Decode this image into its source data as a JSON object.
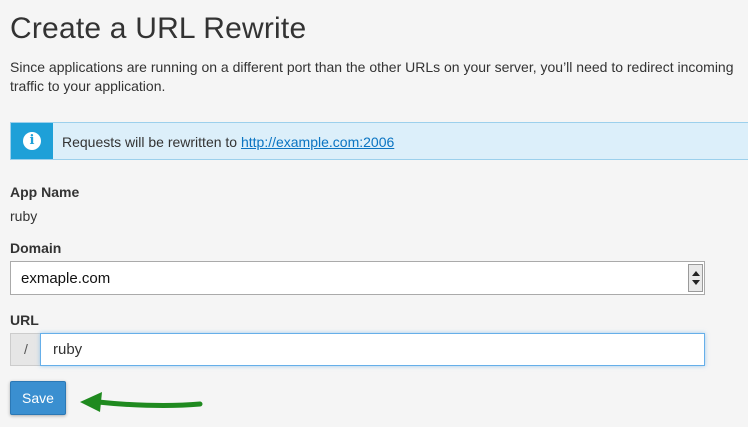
{
  "page": {
    "title": "Create a URL Rewrite",
    "description": "Since applications are running on a different port than the other URLs on your server, you’ll need to redirect incoming traffic to your application."
  },
  "alert": {
    "text": "Requests will be rewritten to ",
    "link": "http://example.com:2006",
    "icon": "info-icon"
  },
  "app": {
    "label": "App Name",
    "value": "ruby"
  },
  "domain": {
    "label": "Domain",
    "selected": "exmaple.com"
  },
  "url": {
    "label": "URL",
    "prefix": "/",
    "value": "ruby"
  },
  "actions": {
    "save_label": "Save"
  },
  "colors": {
    "primary": "#3a8fd0",
    "info": "#1ea0d8",
    "annotation_arrow": "#1f8a1f"
  }
}
